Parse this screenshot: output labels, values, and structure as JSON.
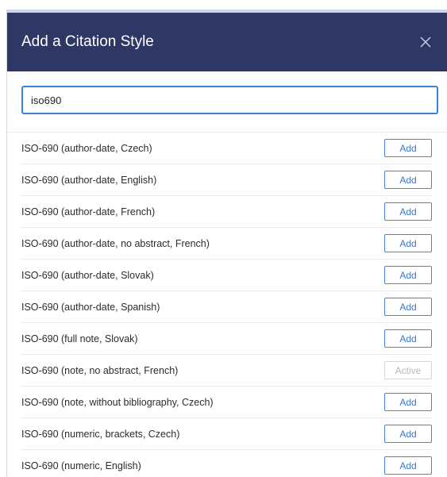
{
  "dialog": {
    "title": "Add a Citation Style",
    "close_icon": "close-icon"
  },
  "search": {
    "value": "iso690",
    "placeholder": ""
  },
  "styles": [
    {
      "name": "ISO-690 (author-date, Czech)",
      "button": "Add"
    },
    {
      "name": "ISO-690 (author-date, English)",
      "button": "Add"
    },
    {
      "name": "ISO-690 (author-date, French)",
      "button": "Add"
    },
    {
      "name": "ISO-690 (author-date, no abstract, French)",
      "button": "Add"
    },
    {
      "name": "ISO-690 (author-date, Slovak)",
      "button": "Add"
    },
    {
      "name": "ISO-690 (author-date, Spanish)",
      "button": "Add"
    },
    {
      "name": "ISO-690 (full note, Slovak)",
      "button": "Add"
    },
    {
      "name": "ISO-690 (note, no abstract, French)",
      "button": "Active"
    },
    {
      "name": "ISO-690 (note, without bibliography, Czech)",
      "button": "Add"
    },
    {
      "name": "ISO-690 (numeric, brackets, Czech)",
      "button": "Add"
    },
    {
      "name": "ISO-690 (numeric, English)",
      "button": "Add"
    }
  ],
  "colors": {
    "header_bg": "#2f3864",
    "accent": "#3b82d6",
    "button_text": "#3e76c7",
    "inactive": "#b5b8be"
  }
}
